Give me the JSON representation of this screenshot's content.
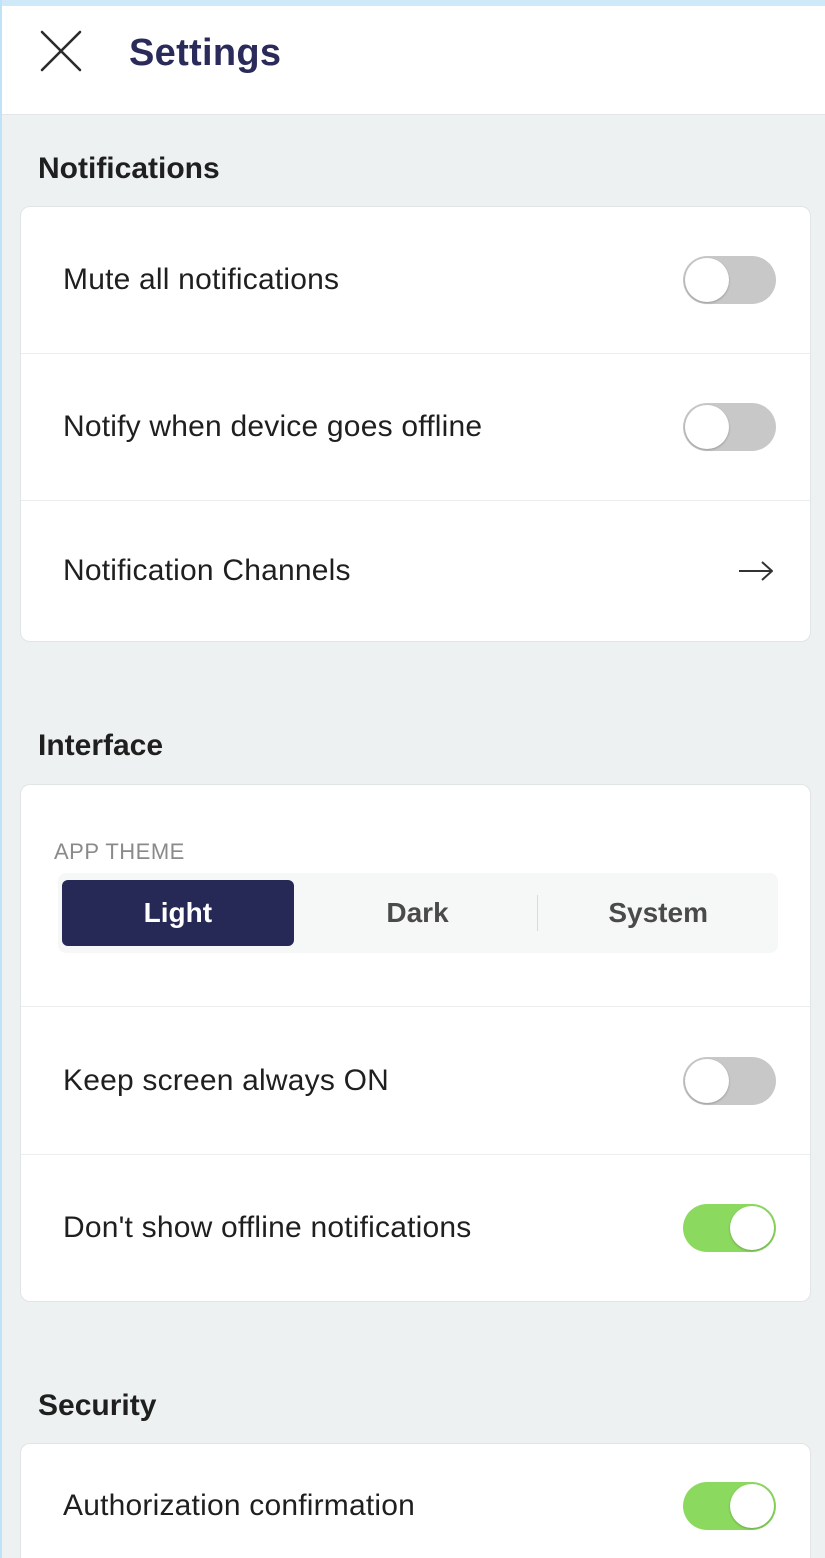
{
  "header": {
    "title": "Settings",
    "close_icon": "close-icon"
  },
  "sections": {
    "notifications": {
      "title": "Notifications",
      "rows": [
        {
          "label": "Mute all notifications",
          "control": "toggle",
          "on": false
        },
        {
          "label": "Notify when device goes offline",
          "control": "toggle",
          "on": false
        },
        {
          "label": "Notification Channels",
          "control": "arrow-right-icon"
        }
      ]
    },
    "interface": {
      "title": "Interface",
      "theme": {
        "label": "APP THEME",
        "options": [
          "Light",
          "Dark",
          "System"
        ],
        "selected": "Light"
      },
      "rows": [
        {
          "label": "Keep screen always ON",
          "control": "toggle",
          "on": false
        },
        {
          "label": "Don't show offline notifications",
          "control": "toggle",
          "on": true
        }
      ]
    },
    "security": {
      "title": "Security",
      "rows": [
        {
          "label": "Authorization confirmation",
          "control": "toggle",
          "on": true
        }
      ]
    }
  },
  "colors": {
    "title": "#2a2b5a",
    "toggle_on": "#8cd95f",
    "toggle_off": "#c8c8c8",
    "segment_active": "#262856"
  }
}
